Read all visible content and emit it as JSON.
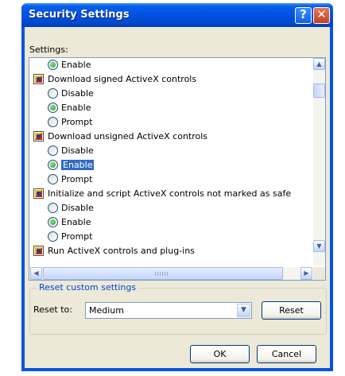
{
  "window": {
    "title": "Security Settings",
    "help_glyph": "?",
    "close_glyph": "✕"
  },
  "settings": {
    "label": "Settings:",
    "rows": [
      {
        "kind": "option",
        "label": "Enable",
        "checked": true,
        "selected": false
      },
      {
        "kind": "category",
        "label": "Download signed ActiveX controls"
      },
      {
        "kind": "option",
        "label": "Disable",
        "checked": false,
        "selected": false
      },
      {
        "kind": "option",
        "label": "Enable",
        "checked": true,
        "selected": false
      },
      {
        "kind": "option",
        "label": "Prompt",
        "checked": false,
        "selected": false
      },
      {
        "kind": "category",
        "label": "Download unsigned ActiveX controls"
      },
      {
        "kind": "option",
        "label": "Disable",
        "checked": false,
        "selected": false
      },
      {
        "kind": "option",
        "label": "Enable",
        "checked": true,
        "selected": true
      },
      {
        "kind": "option",
        "label": "Prompt",
        "checked": false,
        "selected": false
      },
      {
        "kind": "category",
        "label": "Initialize and script ActiveX controls not marked as safe"
      },
      {
        "kind": "option",
        "label": "Disable",
        "checked": false,
        "selected": false
      },
      {
        "kind": "option",
        "label": "Enable",
        "checked": true,
        "selected": false
      },
      {
        "kind": "option",
        "label": "Prompt",
        "checked": false,
        "selected": false
      },
      {
        "kind": "category",
        "label": "Run ActiveX controls and plug-ins"
      }
    ]
  },
  "scrollbars": {
    "up": "▲",
    "down": "▼",
    "left": "◀",
    "right": "▶"
  },
  "reset": {
    "group_label": "Reset custom settings",
    "reset_to_label": "Reset to:",
    "selected_level": "Medium",
    "reset_button": "Reset",
    "dropdown_glyph": "▼"
  },
  "footer": {
    "ok": "OK",
    "cancel": "Cancel"
  },
  "colors": {
    "titlebar": "#0054e3",
    "dialog_bg": "#ece9d8",
    "selection": "#316ac5",
    "group_label": "#0046d5",
    "radio_checked": "#21a121"
  }
}
